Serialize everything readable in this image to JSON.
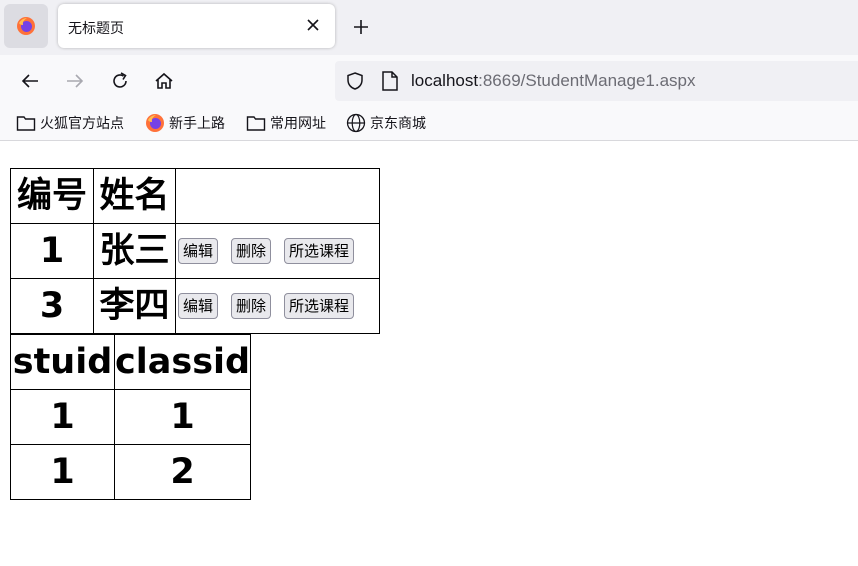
{
  "browser": {
    "tab": {
      "title": "无标题页"
    },
    "url": {
      "host": "localhost",
      "rest": ":8669/StudentManage1.aspx"
    },
    "bookmarks": [
      {
        "label": "火狐官方站点",
        "icon": "folder-icon"
      },
      {
        "label": "新手上路",
        "icon": "firefox-icon"
      },
      {
        "label": "常用网址",
        "icon": "folder-icon"
      },
      {
        "label": "京东商城",
        "icon": "globe-icon"
      }
    ]
  },
  "students": {
    "headers": [
      "编号",
      "姓名",
      ""
    ],
    "rows": [
      {
        "id": "1",
        "name": "张三"
      },
      {
        "id": "3",
        "name": "李四"
      }
    ],
    "actions": {
      "edit": "编辑",
      "delete": "删除",
      "courses": "所选课程"
    }
  },
  "selections": {
    "headers": [
      "stuid",
      "classid"
    ],
    "rows": [
      [
        "1",
        "1"
      ],
      [
        "1",
        "2"
      ]
    ]
  }
}
